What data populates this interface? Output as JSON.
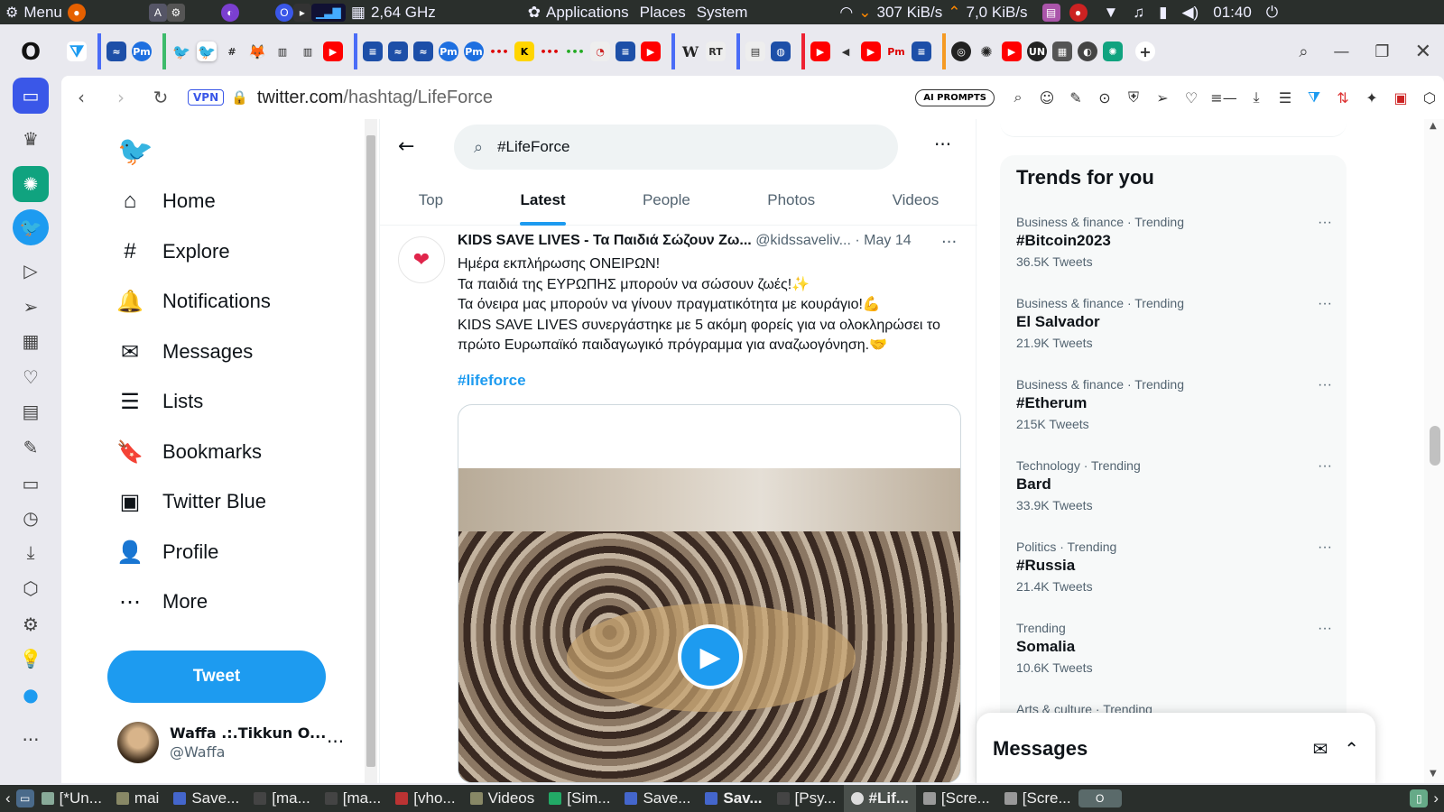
{
  "top_panel": {
    "menu_label": "Menu",
    "cpu_freq": "2,64 GHz",
    "applications": "Applications",
    "places": "Places",
    "system": "System",
    "net_down": "307 KiB/s",
    "net_up": "7,0 KiB/s",
    "clock": "01:40"
  },
  "address_bar": {
    "vpn": "VPN",
    "url_host": "twitter.com",
    "url_path": "/hashtag/LifeForce",
    "ai_prompts": "AI PROMPTS"
  },
  "left_nav": {
    "items": [
      {
        "label": "Home",
        "icon": "home-icon"
      },
      {
        "label": "Explore",
        "icon": "hashtag-icon"
      },
      {
        "label": "Notifications",
        "icon": "bell-icon"
      },
      {
        "label": "Messages",
        "icon": "envelope-icon"
      },
      {
        "label": "Lists",
        "icon": "list-icon"
      },
      {
        "label": "Bookmarks",
        "icon": "bookmark-icon"
      },
      {
        "label": "Twitter Blue",
        "icon": "twitter-blue-icon"
      },
      {
        "label": "Profile",
        "icon": "person-icon"
      },
      {
        "label": "More",
        "icon": "more-circle-icon"
      }
    ],
    "tweet_button": "Tweet",
    "account": {
      "name": "Waffa .:.Tikkun O...",
      "handle": "@Waffa"
    }
  },
  "search": {
    "value": "#LifeForce"
  },
  "tabs": [
    "Top",
    "Latest",
    "People",
    "Photos",
    "Videos"
  ],
  "tweet": {
    "author": "KIDS SAVE LIVES - Τα Παιδιά Σώζουν Ζω...",
    "handle": "@kidssaveliv...",
    "date": "· May 14",
    "lines": [
      "Ημέρα εκπλήρωσης ΟΝΕΙΡΩΝ!",
      "Τα παιδιά της ΕΥΡΩΠΗΣ μπορούν να σώσουν ζωές!✨",
      "Τα όνειρα μας μπορούν να γίνουν πραγματικότητα με κουράγιο!💪",
      "KIDS SAVE LIVES συνεργάστηκε με 5 ακόμη φορείς για να ολοκληρώσει το",
      "πρώτο Ευρωπαϊκό παιδαγωγικό πρόγραμμα για αναζωογόνηση.🤝"
    ],
    "hashtag": "#lifeforce"
  },
  "trends": {
    "title": "Trends for you",
    "items": [
      {
        "category": "Business & finance · Trending",
        "name": "#Bitcoin2023",
        "count": "36.5K Tweets"
      },
      {
        "category": "Business & finance · Trending",
        "name": "El Salvador",
        "count": "21.9K Tweets"
      },
      {
        "category": "Business & finance · Trending",
        "name": "#Etherum",
        "count": "215K Tweets"
      },
      {
        "category": "Technology · Trending",
        "name": "Bard",
        "count": "33.9K Tweets"
      },
      {
        "category": "Politics · Trending",
        "name": "#Russia",
        "count": "21.4K Tweets"
      },
      {
        "category": "Trending",
        "name": "Somalia",
        "count": "10.6K Tweets"
      },
      {
        "category": "Arts & culture · Trending",
        "name": "",
        "count": ""
      }
    ]
  },
  "messages_dock": {
    "title": "Messages"
  },
  "taskbar": [
    {
      "label": "[*Un..."
    },
    {
      "label": "mai"
    },
    {
      "label": "Save..."
    },
    {
      "label": "[ma..."
    },
    {
      "label": "[ma..."
    },
    {
      "label": "[vho..."
    },
    {
      "label": "Videos"
    },
    {
      "label": "[Sim..."
    },
    {
      "label": "Save..."
    },
    {
      "label": "Sav..."
    },
    {
      "label": "[Psy..."
    },
    {
      "label": "#Lif..."
    },
    {
      "label": "[Scre..."
    },
    {
      "label": "[Scre..."
    }
  ],
  "colors": {
    "accent": "#1d9bf0",
    "opera_accent": "#3a57e8"
  }
}
